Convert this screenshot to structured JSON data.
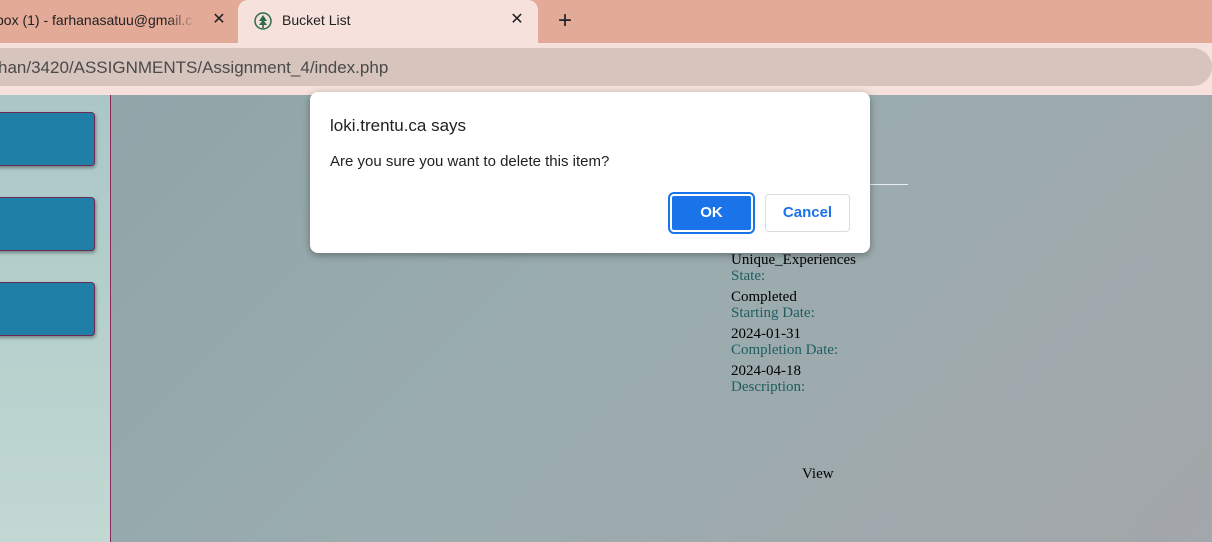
{
  "browser": {
    "tabs": [
      {
        "title": "box (1) - farhanasatuu@gmail.c",
        "close": "✕"
      },
      {
        "title": "Bucket List",
        "close": "✕"
      }
    ],
    "new_tab": "+",
    "url": "han/3420/ASSIGNMENTS/Assignment_4/index.php"
  },
  "details": {
    "category_value": "Unique_Experiences",
    "state_label": "State:",
    "state_value": "Completed",
    "start_label": "Starting Date:",
    "start_value": "2024-01-31",
    "completion_label": "Completion Date:",
    "completion_value": "2024-04-18",
    "description_label": "Description:",
    "view_link": "View"
  },
  "dialog": {
    "origin": "loki.trentu.ca says",
    "message": "Are you sure you want to delete this item?",
    "ok_label": "OK",
    "cancel_label": "Cancel"
  },
  "colors": {
    "tabstrip": "#e3aa97",
    "active_tab": "#f6e1dc",
    "sidebar_button": "#1f7fa6",
    "primary": "#1a73e8"
  }
}
